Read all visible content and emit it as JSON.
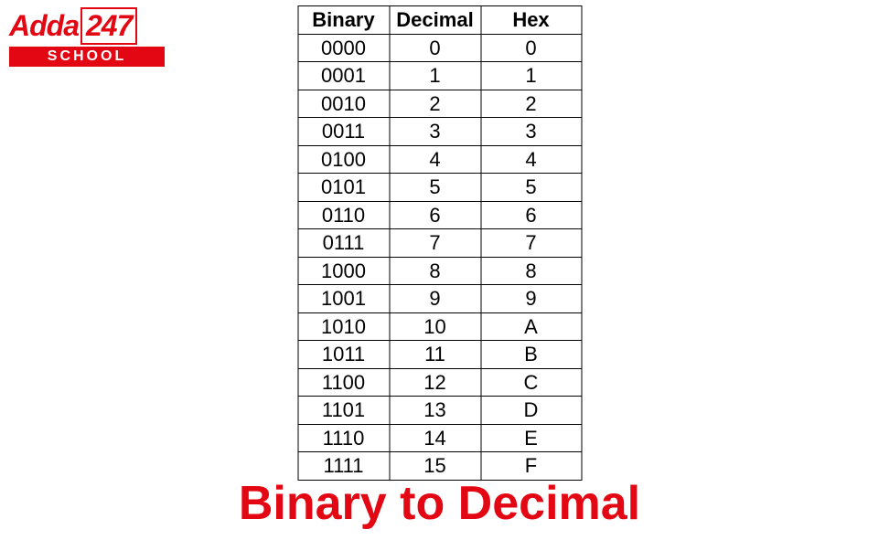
{
  "logo": {
    "brand": "Adda",
    "num": "247",
    "sub": "SCHOOL"
  },
  "chart_data": {
    "type": "table",
    "headers": [
      "Binary",
      "Decimal",
      "Hex"
    ],
    "rows": [
      {
        "binary": "0000",
        "decimal": "0",
        "hex": "0"
      },
      {
        "binary": "0001",
        "decimal": "1",
        "hex": "1"
      },
      {
        "binary": "0010",
        "decimal": "2",
        "hex": "2"
      },
      {
        "binary": "0011",
        "decimal": "3",
        "hex": "3"
      },
      {
        "binary": "0100",
        "decimal": "4",
        "hex": "4"
      },
      {
        "binary": "0101",
        "decimal": "5",
        "hex": "5"
      },
      {
        "binary": "0110",
        "decimal": "6",
        "hex": "6"
      },
      {
        "binary": "0111",
        "decimal": "7",
        "hex": "7"
      },
      {
        "binary": "1000",
        "decimal": "8",
        "hex": "8"
      },
      {
        "binary": "1001",
        "decimal": "9",
        "hex": "9"
      },
      {
        "binary": "1010",
        "decimal": "10",
        "hex": "A"
      },
      {
        "binary": "1011",
        "decimal": "11",
        "hex": "B"
      },
      {
        "binary": "1100",
        "decimal": "12",
        "hex": "C"
      },
      {
        "binary": "1101",
        "decimal": "13",
        "hex": "D"
      },
      {
        "binary": "1110",
        "decimal": "14",
        "hex": "E"
      },
      {
        "binary": "1111",
        "decimal": "15",
        "hex": "F"
      }
    ]
  },
  "title": "Binary to Decimal"
}
